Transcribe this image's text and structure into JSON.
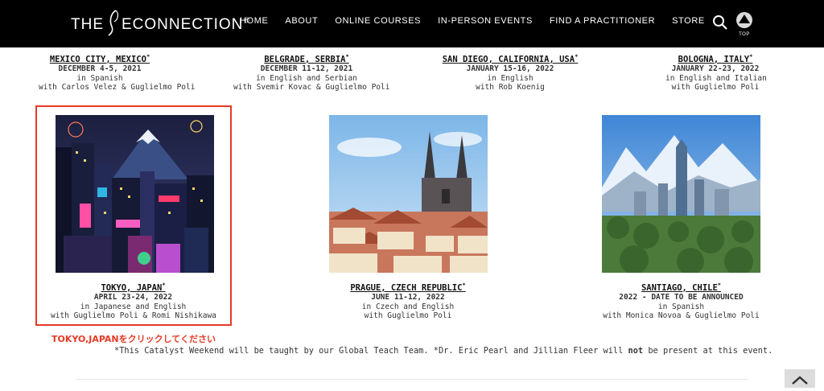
{
  "header": {
    "logo_left": "THE",
    "logo_right": "ECONNECTION",
    "logo_reg": "®",
    "nav": [
      "HOME",
      "ABOUT",
      "ONLINE COURSES",
      "IN-PERSON EVENTS",
      "FIND A PRACTITIONER",
      "STORE"
    ],
    "top_badge": "TOP"
  },
  "events_top": [
    {
      "city": "MEXICO CITY, MEXICO",
      "sup": "*",
      "date": "DECEMBER 4-5, 2021",
      "lang": "in Spanish",
      "with": "with Carlos Velez & Guglielmo Poli"
    },
    {
      "city": "BELGRADE, SERBIA",
      "sup": "*",
      "date": "DECEMBER 11-12, 2021",
      "lang": "in English and Serbian",
      "with": "with Svemir Kovac & Guglielmo Poli"
    },
    {
      "city": "SAN DIEGO, CALIFORNIA, USA",
      "sup": "*",
      "date": "JANUARY 15-16, 2022",
      "lang": "in English",
      "with": "with Rob Koenig"
    },
    {
      "city": "BOLOGNA, ITALY",
      "sup": "*",
      "date": "JANUARY 22-23, 2022",
      "lang": "in English and Italian",
      "with": "with Guglielmo Poli"
    }
  ],
  "events_bottom": [
    {
      "city": "TOKYO, JAPAN",
      "sup": "*",
      "date": "APRIL 23-24, 2022",
      "lang": "in Japanese and English",
      "with": "with Guglielmo Poli & Romi Nishikawa"
    },
    {
      "city": "PRAGUE, CZECH REPUBLIC",
      "sup": "*",
      "date": "JUNE 11-12, 2022",
      "lang": "in Czech and English",
      "with": "with Guglielmo Poli"
    },
    {
      "city": "SANTIAGO, CHILE",
      "sup": "*",
      "date": "2022 - DATE TO BE ANNOUNCED",
      "lang": "in Spanish",
      "with": "with Monica Novoa & Guglielmo Poli"
    }
  ],
  "annotation": "TOKYO,JAPANをクリックしてください",
  "footnote": {
    "before": "*This Catalyst Weekend will be taught by our Global Teach Team. *Dr. Eric Pearl and Jillian Fleer will ",
    "bold": "not",
    "after": " be present at this event."
  },
  "colors": {
    "header_bg": "#000000",
    "highlight": "#e53a25"
  }
}
